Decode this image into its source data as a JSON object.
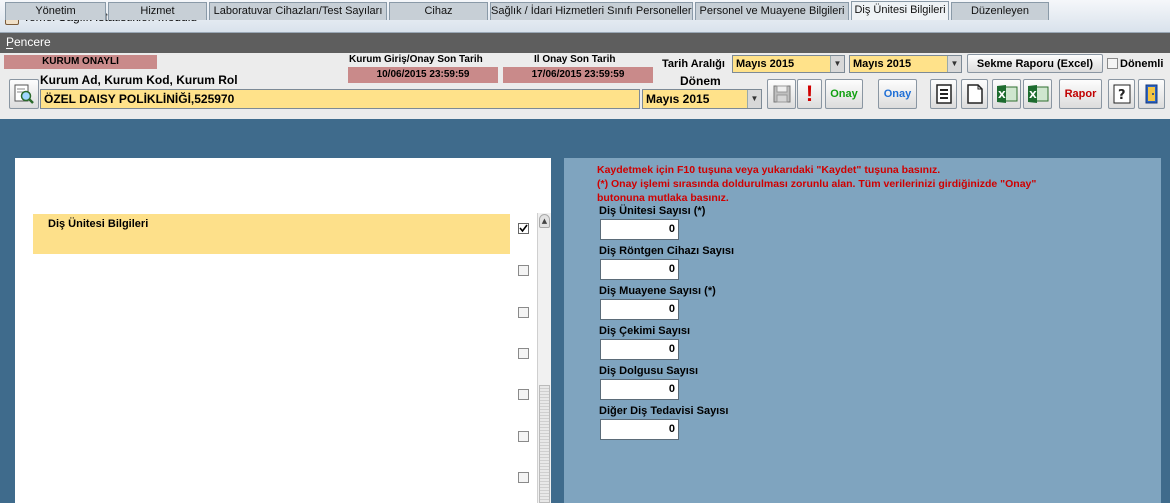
{
  "window": {
    "title": "Temel Sağlık İstatistikleri Modülü"
  },
  "menu": {
    "pencere": "Pencere"
  },
  "header": {
    "kurum_status": "KURUM ONAYLI",
    "kurum_info_label": "Kurum Ad, Kurum Kod, Kurum Rol",
    "kurum_value": "ÖZEL DAISY POLİKLİNİĞİ,525970",
    "giris_label": "Kurum Giriş/Onay Son Tarih",
    "giris_date": "10/06/2015 23:59:59",
    "il_onay_label": "Il Onay Son Tarih",
    "il_onay_date": "17/06/2015 23:59:59",
    "tarih_araligi_label": "Tarih Aralığı",
    "tarih_from": "Mayıs   2015",
    "tarih_to": "Mayıs   2015",
    "sekme_raporu": "Sekme Raporu (Excel)",
    "donemli_label": "Dönemli",
    "donem_label": "Dönem",
    "donem_value": "Mayıs   2015",
    "onay_green": "Onay",
    "onay_blue": "Onay",
    "rapor": "Rapor"
  },
  "tabs": [
    {
      "label": "Yönetim"
    },
    {
      "label": "Hizmet"
    },
    {
      "label": "Laboratuvar Cihazları/Test Sayıları"
    },
    {
      "label": "Cihaz"
    },
    {
      "label": "Sağlık / İdari Hizmetleri Sınıfı Personelleri"
    },
    {
      "label": "Personel ve Muayene Bilgileri"
    },
    {
      "label": "Diş Ünitesi Bilgileri"
    },
    {
      "label": "Düzenleyen"
    }
  ],
  "left": {
    "item_label": "Diş Ünitesi Bilgileri"
  },
  "warnings": {
    "line1": "Kaydetmek için F10 tuşuna veya yukarıdaki \"Kaydet\" tuşuna basınız.",
    "line2": "(*) Onay işlemi sırasında doldurulması zorunlu alan. Tüm verilerinizi girdiğinizde \"Onay\"",
    "line3": "butonuna mutlaka basınız."
  },
  "form": [
    {
      "label": "Diş Ünitesi Sayısı (*)",
      "value": "0"
    },
    {
      "label": "Diş Röntgen Cihazı Sayısı",
      "value": "0"
    },
    {
      "label": "Diş Muayene Sayısı (*)",
      "value": "0"
    },
    {
      "label": "Diş Çekimi Sayısı",
      "value": "0"
    },
    {
      "label": "Diş Dolgusu Sayısı",
      "value": "0"
    },
    {
      "label": "Diğer Diş Tedavisi Sayısı",
      "value": "0"
    }
  ]
}
